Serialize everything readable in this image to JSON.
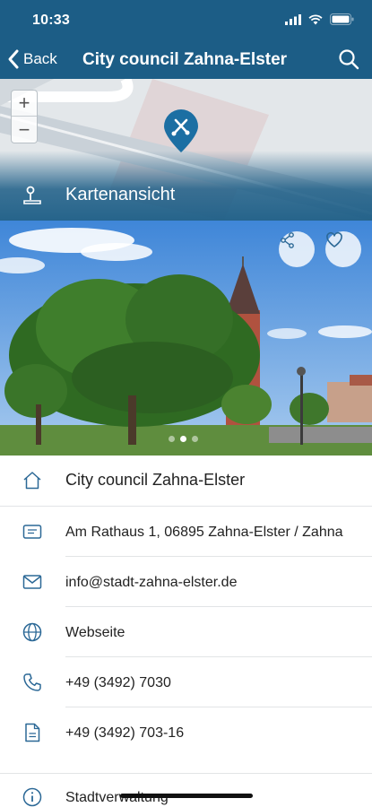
{
  "status_bar": {
    "time": "10:33"
  },
  "nav": {
    "back_label": "Back",
    "title": "City council Zahna-Elster"
  },
  "map": {
    "zoom_in_label": "+",
    "zoom_out_label": "−",
    "view_label": "Kartenansicht"
  },
  "photo": {
    "slide_count": 3,
    "active_slide": 2
  },
  "details": {
    "name": "City council Zahna-Elster",
    "address": "Am Rathaus 1, 06895 Zahna-Elster / Zahna",
    "email": "info@stadt-zahna-elster.de",
    "website": "Webseite",
    "phone": "+49 (3492) 7030",
    "fax": "+49 (3492) 703-16",
    "category": "Stadtverwaltung"
  },
  "colors": {
    "accent": "#1c5d86",
    "icon": "#2b6896"
  },
  "icons": {
    "back": "chevron-left-icon",
    "search": "search-icon",
    "map_view": "location-person-icon",
    "pin": "tools-pin-icon",
    "share": "share-icon",
    "favorite": "heart-icon",
    "home": "home-icon",
    "address": "address-card-icon",
    "email": "mail-icon",
    "website": "globe-icon",
    "phone": "phone-icon",
    "fax": "document-icon",
    "info": "info-icon"
  }
}
